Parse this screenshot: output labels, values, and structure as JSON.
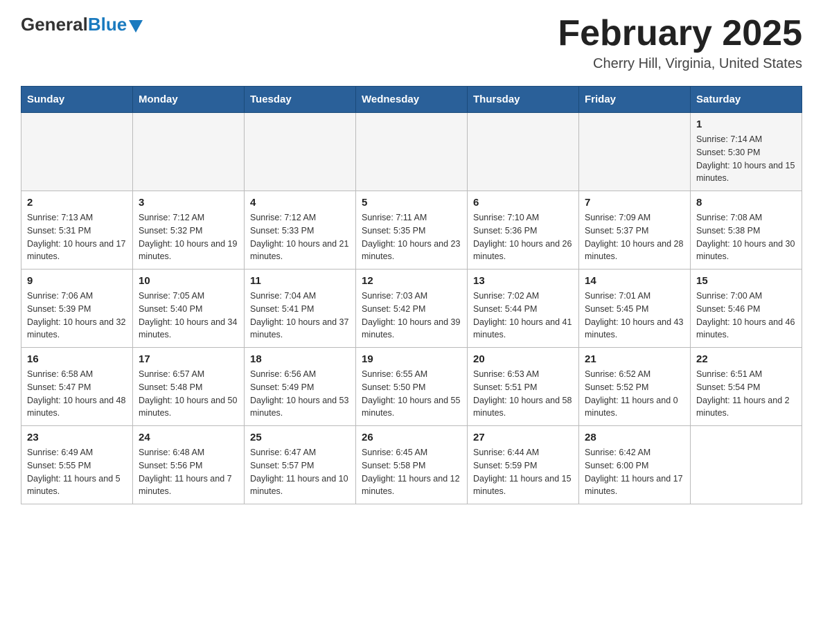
{
  "logo": {
    "general": "General",
    "blue": "Blue"
  },
  "title": "February 2025",
  "subtitle": "Cherry Hill, Virginia, United States",
  "weekdays": [
    "Sunday",
    "Monday",
    "Tuesday",
    "Wednesday",
    "Thursday",
    "Friday",
    "Saturday"
  ],
  "weeks": [
    [
      {
        "day": "",
        "info": ""
      },
      {
        "day": "",
        "info": ""
      },
      {
        "day": "",
        "info": ""
      },
      {
        "day": "",
        "info": ""
      },
      {
        "day": "",
        "info": ""
      },
      {
        "day": "",
        "info": ""
      },
      {
        "day": "1",
        "info": "Sunrise: 7:14 AM\nSunset: 5:30 PM\nDaylight: 10 hours and 15 minutes."
      }
    ],
    [
      {
        "day": "2",
        "info": "Sunrise: 7:13 AM\nSunset: 5:31 PM\nDaylight: 10 hours and 17 minutes."
      },
      {
        "day": "3",
        "info": "Sunrise: 7:12 AM\nSunset: 5:32 PM\nDaylight: 10 hours and 19 minutes."
      },
      {
        "day": "4",
        "info": "Sunrise: 7:12 AM\nSunset: 5:33 PM\nDaylight: 10 hours and 21 minutes."
      },
      {
        "day": "5",
        "info": "Sunrise: 7:11 AM\nSunset: 5:35 PM\nDaylight: 10 hours and 23 minutes."
      },
      {
        "day": "6",
        "info": "Sunrise: 7:10 AM\nSunset: 5:36 PM\nDaylight: 10 hours and 26 minutes."
      },
      {
        "day": "7",
        "info": "Sunrise: 7:09 AM\nSunset: 5:37 PM\nDaylight: 10 hours and 28 minutes."
      },
      {
        "day": "8",
        "info": "Sunrise: 7:08 AM\nSunset: 5:38 PM\nDaylight: 10 hours and 30 minutes."
      }
    ],
    [
      {
        "day": "9",
        "info": "Sunrise: 7:06 AM\nSunset: 5:39 PM\nDaylight: 10 hours and 32 minutes."
      },
      {
        "day": "10",
        "info": "Sunrise: 7:05 AM\nSunset: 5:40 PM\nDaylight: 10 hours and 34 minutes."
      },
      {
        "day": "11",
        "info": "Sunrise: 7:04 AM\nSunset: 5:41 PM\nDaylight: 10 hours and 37 minutes."
      },
      {
        "day": "12",
        "info": "Sunrise: 7:03 AM\nSunset: 5:42 PM\nDaylight: 10 hours and 39 minutes."
      },
      {
        "day": "13",
        "info": "Sunrise: 7:02 AM\nSunset: 5:44 PM\nDaylight: 10 hours and 41 minutes."
      },
      {
        "day": "14",
        "info": "Sunrise: 7:01 AM\nSunset: 5:45 PM\nDaylight: 10 hours and 43 minutes."
      },
      {
        "day": "15",
        "info": "Sunrise: 7:00 AM\nSunset: 5:46 PM\nDaylight: 10 hours and 46 minutes."
      }
    ],
    [
      {
        "day": "16",
        "info": "Sunrise: 6:58 AM\nSunset: 5:47 PM\nDaylight: 10 hours and 48 minutes."
      },
      {
        "day": "17",
        "info": "Sunrise: 6:57 AM\nSunset: 5:48 PM\nDaylight: 10 hours and 50 minutes."
      },
      {
        "day": "18",
        "info": "Sunrise: 6:56 AM\nSunset: 5:49 PM\nDaylight: 10 hours and 53 minutes."
      },
      {
        "day": "19",
        "info": "Sunrise: 6:55 AM\nSunset: 5:50 PM\nDaylight: 10 hours and 55 minutes."
      },
      {
        "day": "20",
        "info": "Sunrise: 6:53 AM\nSunset: 5:51 PM\nDaylight: 10 hours and 58 minutes."
      },
      {
        "day": "21",
        "info": "Sunrise: 6:52 AM\nSunset: 5:52 PM\nDaylight: 11 hours and 0 minutes."
      },
      {
        "day": "22",
        "info": "Sunrise: 6:51 AM\nSunset: 5:54 PM\nDaylight: 11 hours and 2 minutes."
      }
    ],
    [
      {
        "day": "23",
        "info": "Sunrise: 6:49 AM\nSunset: 5:55 PM\nDaylight: 11 hours and 5 minutes."
      },
      {
        "day": "24",
        "info": "Sunrise: 6:48 AM\nSunset: 5:56 PM\nDaylight: 11 hours and 7 minutes."
      },
      {
        "day": "25",
        "info": "Sunrise: 6:47 AM\nSunset: 5:57 PM\nDaylight: 11 hours and 10 minutes."
      },
      {
        "day": "26",
        "info": "Sunrise: 6:45 AM\nSunset: 5:58 PM\nDaylight: 11 hours and 12 minutes."
      },
      {
        "day": "27",
        "info": "Sunrise: 6:44 AM\nSunset: 5:59 PM\nDaylight: 11 hours and 15 minutes."
      },
      {
        "day": "28",
        "info": "Sunrise: 6:42 AM\nSunset: 6:00 PM\nDaylight: 11 hours and 17 minutes."
      },
      {
        "day": "",
        "info": ""
      }
    ]
  ]
}
